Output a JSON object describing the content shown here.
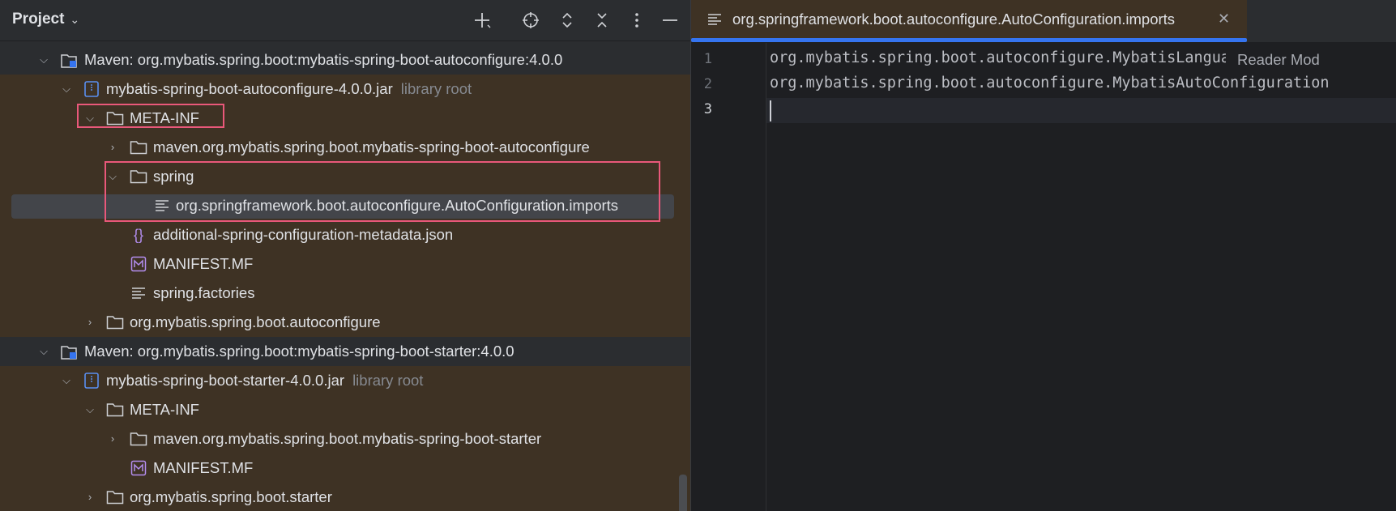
{
  "project_panel": {
    "title": "Project",
    "toolbar": [
      {
        "name": "new-file-icon",
        "glyph": "+"
      },
      {
        "name": "locate-icon",
        "glyph": "⊕"
      },
      {
        "name": "expand-all-icon",
        "glyph": "⌃"
      },
      {
        "name": "collapse-all-icon",
        "glyph": "✕"
      },
      {
        "name": "more-options-icon",
        "glyph": "⋮"
      },
      {
        "name": "hide-icon",
        "glyph": "—"
      }
    ],
    "tree": [
      {
        "label": "Maven: org.mybatis.spring.boot:mybatis-spring-boot-autoconfigure:4.0.0",
        "hint": ""
      },
      {
        "label": "mybatis-spring-boot-autoconfigure-4.0.0.jar",
        "hint": "library root"
      },
      {
        "label": "META-INF",
        "hint": ""
      },
      {
        "label": "maven.org.mybatis.spring.boot.mybatis-spring-boot-autoconfigure",
        "hint": ""
      },
      {
        "label": "spring",
        "hint": ""
      },
      {
        "label": "org.springframework.boot.autoconfigure.AutoConfiguration.imports",
        "hint": ""
      },
      {
        "label": "additional-spring-configuration-metadata.json",
        "hint": ""
      },
      {
        "label": "MANIFEST.MF",
        "hint": ""
      },
      {
        "label": "spring.factories",
        "hint": ""
      },
      {
        "label": "org.mybatis.spring.boot.autoconfigure",
        "hint": ""
      },
      {
        "label": "Maven: org.mybatis.spring.boot:mybatis-spring-boot-starter:4.0.0",
        "hint": ""
      },
      {
        "label": "mybatis-spring-boot-starter-4.0.0.jar",
        "hint": "library root"
      },
      {
        "label": "META-INF",
        "hint": ""
      },
      {
        "label": "maven.org.mybatis.spring.boot.mybatis-spring-boot-starter",
        "hint": ""
      },
      {
        "label": "MANIFEST.MF",
        "hint": ""
      },
      {
        "label": "org.mybatis.spring.boot.starter",
        "hint": ""
      }
    ]
  },
  "editor": {
    "tab_label": "org.springframework.boot.autoconfigure.AutoConfiguration.imports",
    "close_glyph": "✕",
    "line_numbers": [
      "1",
      "2",
      "3"
    ],
    "lines": [
      "org.mybatis.spring.boot.autoconfigure.MybatisLanguage",
      "org.mybatis.spring.boot.autoconfigure.MybatisAutoConfiguration",
      ""
    ],
    "reader_mode_label": "Reader Mod"
  },
  "colors": {
    "highlight_box": "#e9587a",
    "tab_underline": "#3574f0",
    "module_row_bg": "#3e3224"
  }
}
